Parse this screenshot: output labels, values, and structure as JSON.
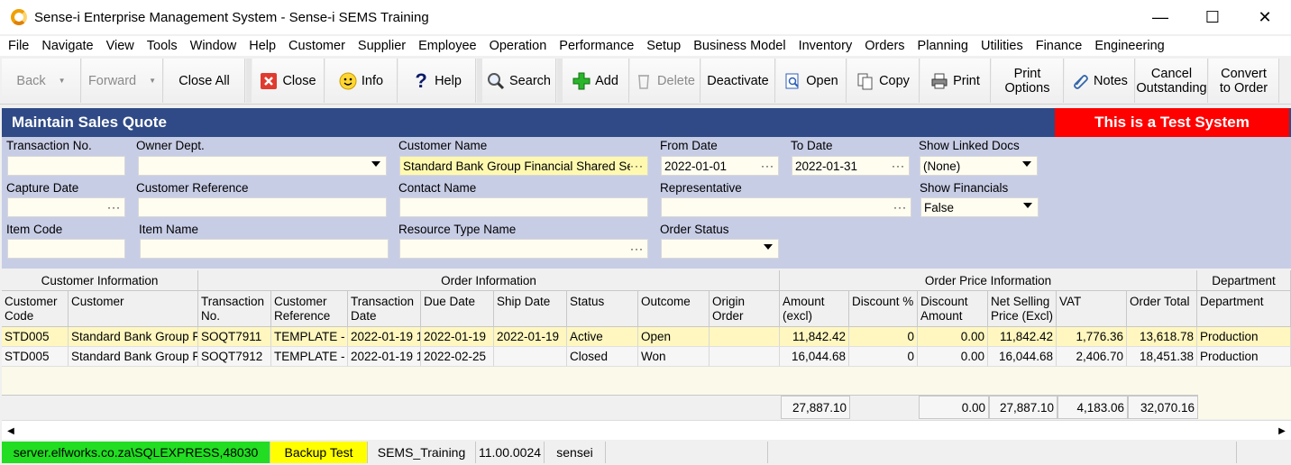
{
  "window": {
    "title": "Sense-i Enterprise Management System - Sense-i SEMS Training",
    "minimize": "—",
    "maximize": "☐",
    "close": "✕"
  },
  "menu": [
    "File",
    "Navigate",
    "View",
    "Tools",
    "Window",
    "Help",
    "Customer",
    "Supplier",
    "Employee",
    "Operation",
    "Performance",
    "Setup",
    "Business Model",
    "Inventory",
    "Orders",
    "Planning",
    "Utilities",
    "Finance",
    "Engineering"
  ],
  "toolbar": {
    "back": "Back",
    "forward": "Forward",
    "close_all": "Close All",
    "close": "Close",
    "info": "Info",
    "help": "Help",
    "search": "Search",
    "add": "Add",
    "delete": "Delete",
    "deactivate": "Deactivate",
    "open": "Open",
    "copy": "Copy",
    "print": "Print",
    "print_options_1": "Print",
    "print_options_2": "Options",
    "notes": "Notes",
    "cancel_outstanding_1": "Cancel",
    "cancel_outstanding_2": "Outstanding",
    "convert_1": "Convert",
    "convert_2": "to Order"
  },
  "form": {
    "title": "Maintain Sales Quote",
    "test_banner": "This is a Test System"
  },
  "filters": {
    "transaction_no": {
      "label": "Transaction No.",
      "value": ""
    },
    "owner_dept": {
      "label": "Owner Dept.",
      "value": ""
    },
    "customer_name": {
      "label": "Customer Name",
      "value": "Standard Bank Group Financial Shared Se"
    },
    "from_date": {
      "label": "From Date",
      "value": "2022-01-01"
    },
    "to_date": {
      "label": "To Date",
      "value": "2022-01-31"
    },
    "show_linked_docs": {
      "label": "Show Linked Docs",
      "value": "(None)"
    },
    "capture_date": {
      "label": "Capture Date",
      "value": ""
    },
    "customer_reference": {
      "label": "Customer Reference",
      "value": ""
    },
    "contact_name": {
      "label": "Contact Name",
      "value": ""
    },
    "representative": {
      "label": "Representative",
      "value": ""
    },
    "show_financials": {
      "label": "Show Financials",
      "value": "False"
    },
    "item_code": {
      "label": "Item Code",
      "value": ""
    },
    "item_name": {
      "label": "Item Name",
      "value": ""
    },
    "resource_type_name": {
      "label": "Resource Type Name",
      "value": ""
    },
    "order_status": {
      "label": "Order Status",
      "value": ""
    },
    "ellipsis": "···"
  },
  "grid": {
    "bands": {
      "customer_info": "Customer Information",
      "order_info": "Order Information",
      "order_price_info": "Order Price Information",
      "department": "Department"
    },
    "headers": {
      "customer_code": "Customer Code",
      "customer": "Customer",
      "transaction_no": "Transaction No.",
      "customer_reference": "Customer Reference",
      "transaction_date": "Transaction Date",
      "due_date": "Due Date",
      "ship_date": "Ship Date",
      "status": "Status",
      "outcome": "Outcome",
      "origin_order": "Origin Order",
      "amount_excl": "Amount (excl)",
      "discount_pct": "Discount %",
      "discount_amount": "Discount Amount",
      "net_selling_price": "Net Selling Price (Excl)",
      "vat": "VAT",
      "order_total": "Order Total",
      "department": "Department"
    },
    "rows": [
      {
        "customer_code": "STD005",
        "customer": "Standard Bank Group F",
        "transaction_no": "SOQT7911",
        "customer_reference": "TEMPLATE -",
        "transaction_date": "2022-01-19 1",
        "due_date": "2022-01-19",
        "ship_date": "2022-01-19",
        "status": "Active",
        "outcome": "Open",
        "origin_order": "",
        "amount_excl": "11,842.42",
        "discount_pct": "0",
        "discount_amount": "0.00",
        "net_selling_price": "11,842.42",
        "vat": "1,776.36",
        "order_total": "13,618.78",
        "department": "Production"
      },
      {
        "customer_code": "STD005",
        "customer": "Standard Bank Group F",
        "transaction_no": "SOQT7912",
        "customer_reference": "TEMPLATE -",
        "transaction_date": "2022-01-19 1",
        "due_date": "2022-02-25",
        "ship_date": "",
        "status": "Closed",
        "outcome": "Won",
        "origin_order": "",
        "amount_excl": "16,044.68",
        "discount_pct": "0",
        "discount_amount": "0.00",
        "net_selling_price": "16,044.68",
        "vat": "2,406.70",
        "order_total": "18,451.38",
        "department": "Production"
      }
    ],
    "totals": {
      "amount_excl": "27,887.10",
      "discount_amount": "0.00",
      "net_selling_price": "27,887.10",
      "vat": "4,183.06",
      "order_total": "32,070.16"
    }
  },
  "statusbar": {
    "server": "server.elfworks.co.za\\SQLEXPRESS,48030",
    "backup": "Backup Test",
    "database": "SEMS_Training",
    "version": "11.00.0024",
    "user": "sensei"
  },
  "colors": {
    "header_band": "#2f4a86",
    "test_banner": "#ff0000",
    "filter_panel": "#c8cde6",
    "selected_row": "#fff7bf",
    "status_server": "#22dd22",
    "status_backup": "#ffff00"
  }
}
